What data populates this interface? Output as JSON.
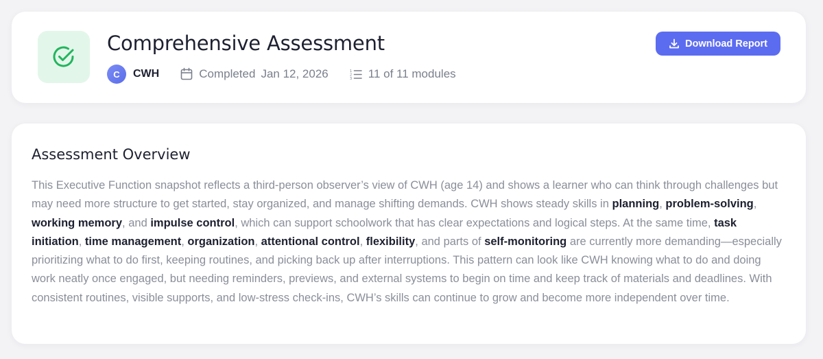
{
  "header": {
    "title": "Comprehensive Assessment",
    "status_icon": "check-circle-icon",
    "user_initial": "C",
    "user_name": "CWH",
    "completed_label": "Completed",
    "completed_date": "Jan 12, 2026",
    "modules_text": "11 of 11 modules",
    "download_label": "Download Report"
  },
  "overview": {
    "title": "Assessment Overview",
    "segments": [
      {
        "text": "This Executive Function snapshot reflects a third-person observer’s view of CWH (age 14) and shows a learner who can think through challenges but may need more structure to get started, stay organized, and manage shifting demands. CWH shows steady skills in ",
        "bold": false
      },
      {
        "text": "planning",
        "bold": true
      },
      {
        "text": ", ",
        "bold": false
      },
      {
        "text": "problem-solving",
        "bold": true
      },
      {
        "text": ", ",
        "bold": false
      },
      {
        "text": "working memory",
        "bold": true
      },
      {
        "text": ", and ",
        "bold": false
      },
      {
        "text": "impulse control",
        "bold": true
      },
      {
        "text": ", which can support schoolwork that has clear expectations and logical steps. At the same time, ",
        "bold": false
      },
      {
        "text": "task initiation",
        "bold": true
      },
      {
        "text": ", ",
        "bold": false
      },
      {
        "text": "time management",
        "bold": true
      },
      {
        "text": ", ",
        "bold": false
      },
      {
        "text": "organization",
        "bold": true
      },
      {
        "text": ", ",
        "bold": false
      },
      {
        "text": "attentional control",
        "bold": true
      },
      {
        "text": ", ",
        "bold": false
      },
      {
        "text": "flexibility",
        "bold": true
      },
      {
        "text": ", and parts of ",
        "bold": false
      },
      {
        "text": "self-monitoring",
        "bold": true
      },
      {
        "text": " are currently more demanding—especially prioritizing what to do first, keeping routines, and picking back up after interruptions. This pattern can look like CWH knowing what to do and doing work neatly once engaged, but needing reminders, previews, and external systems to begin on time and keep track of materials and deadlines. With consistent routines, visible supports, and low-stress check-ins, CWH’s skills can continue to grow and become more independent over time.",
        "bold": false
      }
    ]
  },
  "colors": {
    "accent": "#5c6cf0",
    "success": "#22b55e",
    "success_bg": "#e3f6ea"
  }
}
